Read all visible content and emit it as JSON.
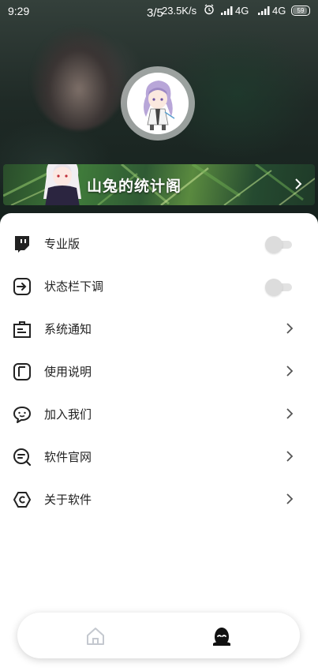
{
  "status_bar": {
    "time": "9:29",
    "image_counter": "3/5",
    "net_speed": "23.5K/s",
    "network_1": "4G",
    "network_2": "4G",
    "battery": "59"
  },
  "profile": {
    "banner_title": "山兔的统计阁"
  },
  "menu": [
    {
      "label": "专业版",
      "control": "toggle",
      "toggle_on": false,
      "icon": "twitch-badge-icon"
    },
    {
      "label": "状态栏下调",
      "control": "toggle",
      "toggle_on": false,
      "icon": "enter-arrow-icon"
    },
    {
      "label": "系统通知",
      "control": "arrow",
      "icon": "notice-board-icon"
    },
    {
      "label": "使用说明",
      "control": "arrow",
      "icon": "manual-icon"
    },
    {
      "label": "加入我们",
      "control": "arrow",
      "icon": "chat-bubble-icon"
    },
    {
      "label": "软件官网",
      "control": "arrow",
      "icon": "website-search-icon"
    },
    {
      "label": "关于软件",
      "control": "arrow",
      "icon": "hexagon-info-icon"
    }
  ],
  "bottom_nav": {
    "items": [
      "home-icon",
      "profile-icon"
    ],
    "active": "profile-icon",
    "active_color": "#111111",
    "inactive_color": "#c4c8cf"
  }
}
